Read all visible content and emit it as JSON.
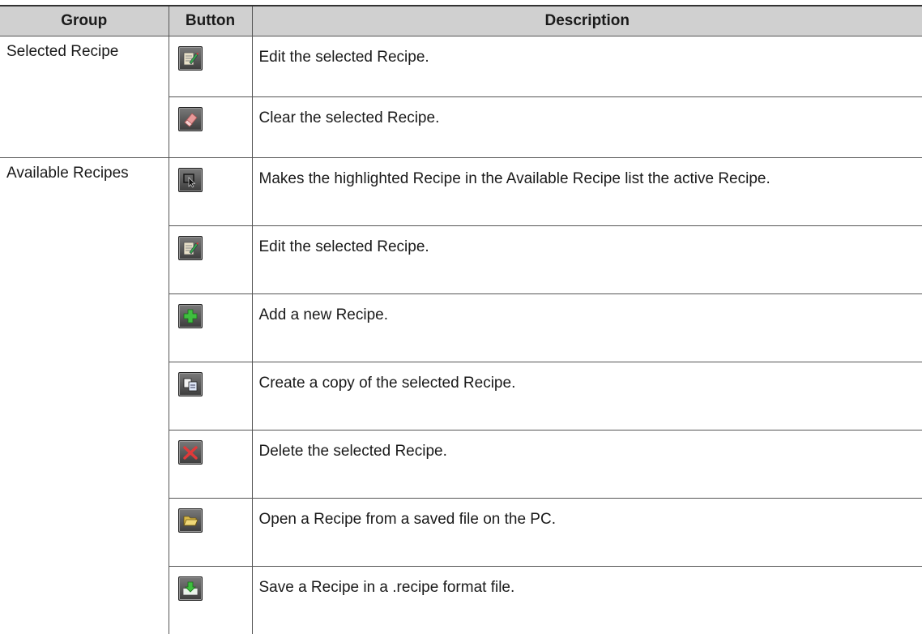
{
  "headers": {
    "group": "Group",
    "button": "Button",
    "description": "Description"
  },
  "groups": [
    {
      "name": "Selected Recipe",
      "rows": [
        {
          "icon": "edit-recipe-icon",
          "description": "Edit the selected Recipe."
        },
        {
          "icon": "eraser-clear-icon",
          "description": "Clear the selected Recipe."
        }
      ]
    },
    {
      "name": "Available Recipes",
      "rows": [
        {
          "icon": "select-cursor-icon",
          "description": "Makes the highlighted Recipe in the Available Recipe list the active Recipe."
        },
        {
          "icon": "edit-recipe-icon",
          "description": "Edit the selected Recipe."
        },
        {
          "icon": "add-plus-icon",
          "description": "Add a new Recipe."
        },
        {
          "icon": "copy-documents-icon",
          "description": "Create a copy of the selected Recipe."
        },
        {
          "icon": "delete-x-icon",
          "description": "Delete the selected Recipe."
        },
        {
          "icon": "open-folder-icon",
          "description": "Open a Recipe from a saved file on the PC."
        },
        {
          "icon": "save-download-icon",
          "description": "Save a Recipe in a .recipe format file."
        }
      ]
    }
  ]
}
